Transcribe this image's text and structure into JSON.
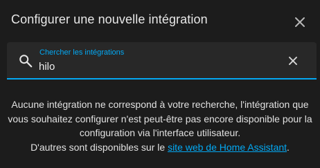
{
  "dialog": {
    "title": "Configurer une nouvelle intégration",
    "close_icon": "close-icon"
  },
  "search": {
    "label": "Chercher les intégrations",
    "value": "hilo",
    "search_icon": "search-icon",
    "clear_icon": "clear-icon"
  },
  "message": {
    "line1": "Aucune intégration ne correspond à votre recherche, l'intégration que",
    "line2": "vous souhaitez configurer n'est peut-être pas encore disponible pour la",
    "line3": "configuration via l'interface utilisateur.",
    "line4_prefix": "D'autres sont disponibles sur le ",
    "link_text": "site web de Home Assistant",
    "line4_suffix": "."
  },
  "colors": {
    "accent": "#03a9f4",
    "background": "#1c1c1c",
    "field_background": "#282828",
    "text": "#e1e1e1"
  }
}
